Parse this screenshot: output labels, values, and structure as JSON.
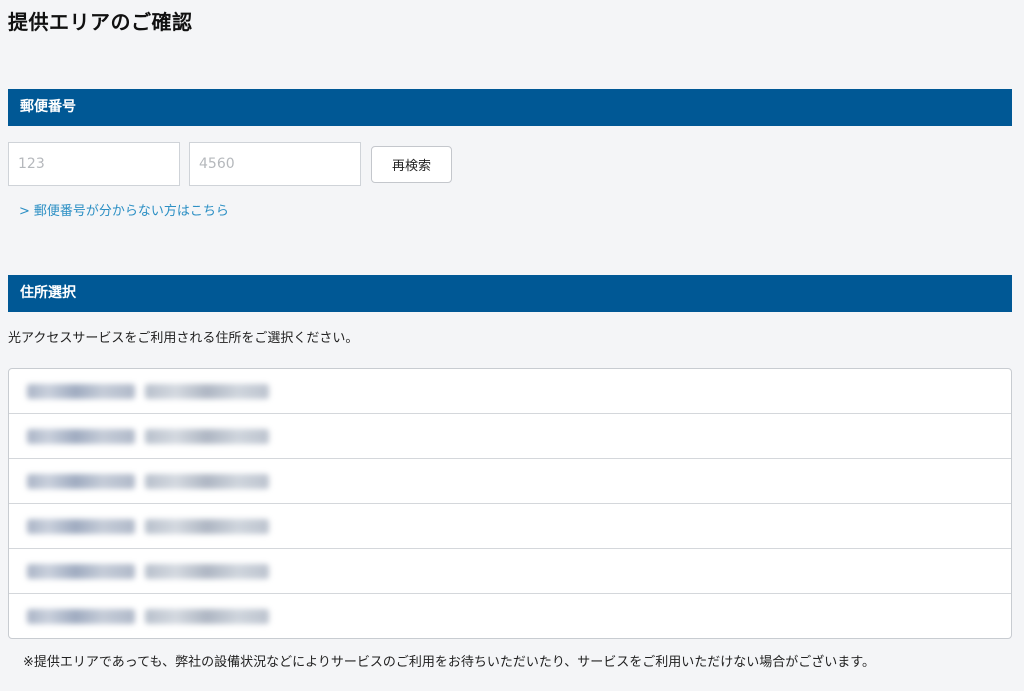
{
  "page": {
    "title": "提供エリアのご確認"
  },
  "postal_section": {
    "header": "郵便番号",
    "zip_first": {
      "value": "",
      "placeholder": "123"
    },
    "zip_second": {
      "value": "",
      "placeholder": "4560"
    },
    "search_button_label": "再検索",
    "help_link_chevron": ">",
    "help_link_label": "郵便番号が分からない方はこちら"
  },
  "address_section": {
    "header": "住所選択",
    "instruction": "光アクセスサービスをご利用される住所をご選択ください。",
    "row_count_visible": 6,
    "rows_note": "blurred"
  },
  "footnote": "※提供エリアであっても、弊社の設備状況などによりサービスのご利用をお待ちいただいたり、サービスをご利用いただけない場合がございます。",
  "colors": {
    "header_bg": "#005895",
    "link": "#2b8fc4",
    "page_bg": "#f4f5f7"
  }
}
